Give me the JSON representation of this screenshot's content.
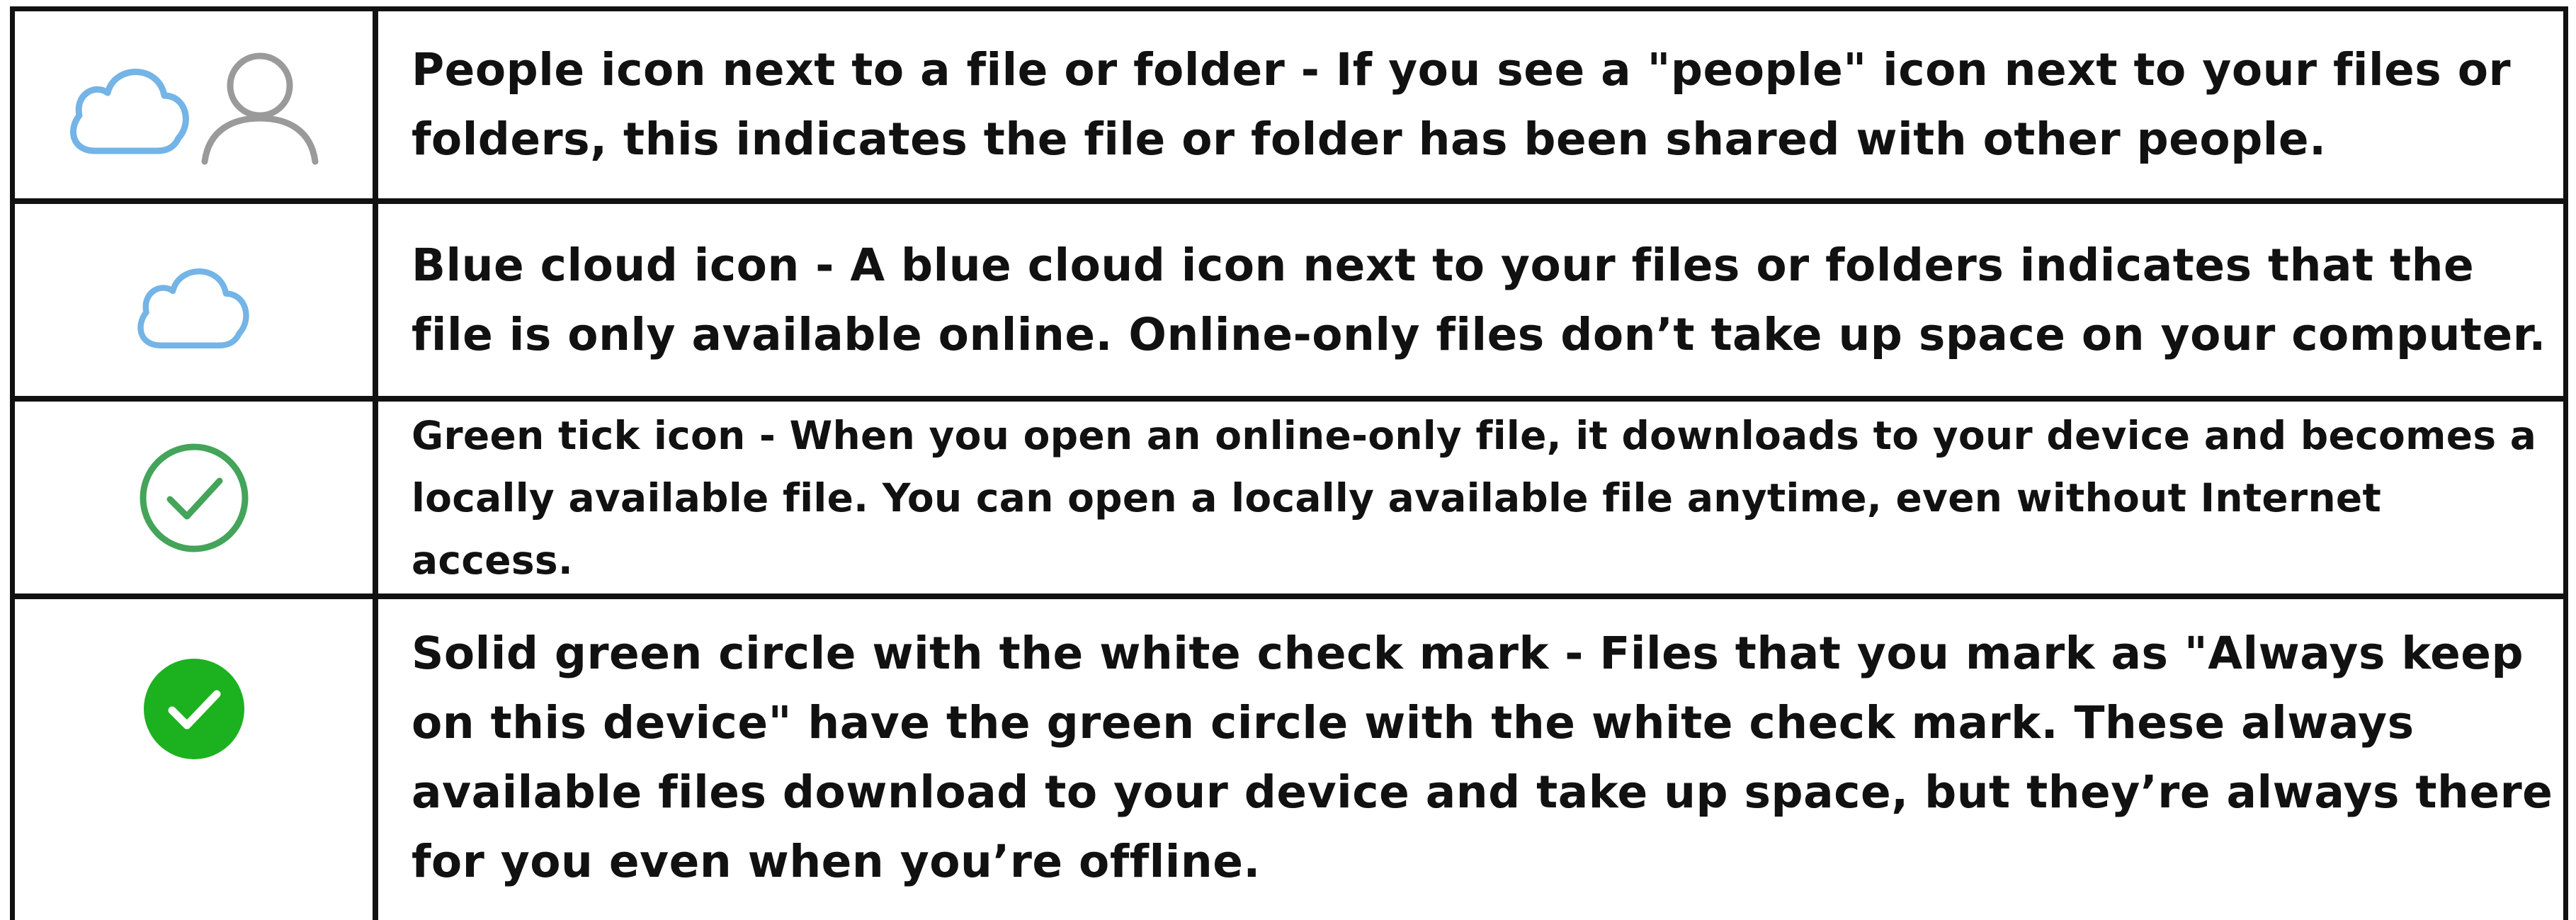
{
  "rows": [
    {
      "icons": [
        "cloud-outline-icon",
        "person-outline-icon"
      ],
      "text": "People icon next to a file or folder  - If you see a \"people\" icon next to your files or folders, this indicates the file or folder has been shared with other people."
    },
    {
      "icons": [
        "cloud-outline-icon"
      ],
      "text": "Blue cloud icon - A blue cloud icon next to your files or folders indicates that the file is only available online. Online-only files don’t take up space on your computer."
    },
    {
      "icons": [
        "green-check-outline-icon"
      ],
      "text": "Green tick icon - When you open an online-only file, it downloads to your device and becomes a locally available file. You can open a locally available file anytime, even without Internet access."
    },
    {
      "icons": [
        "green-check-solid-icon"
      ],
      "text": "Solid green circle with the white check mark  - Files that you mark as \"Always keep on this device\" have the green circle with the white check mark. These always available files download to your device and take up space, but they’re always there for you even when you’re offline."
    }
  ],
  "colors": {
    "cloud_blue": "#74b4e6",
    "person_gray": "#9a9a9a",
    "check_green": "#43a45a",
    "solid_green": "#1cb11f",
    "border": "#111111",
    "text": "#111111"
  }
}
